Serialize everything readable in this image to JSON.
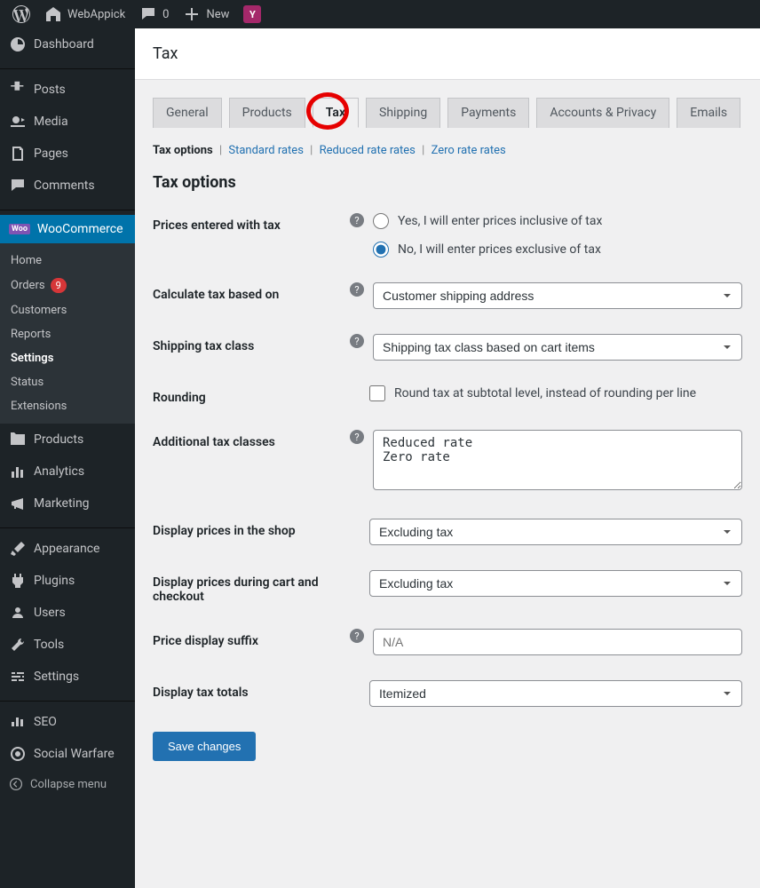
{
  "adminbar": {
    "site_name": "WebAppick",
    "comments": "0",
    "new": "New"
  },
  "sidebar": {
    "dashboard": "Dashboard",
    "posts": "Posts",
    "media": "Media",
    "pages": "Pages",
    "comments": "Comments",
    "woocommerce": "WooCommerce",
    "woo_sub": {
      "home": "Home",
      "orders": "Orders",
      "orders_count": "9",
      "customers": "Customers",
      "reports": "Reports",
      "settings": "Settings",
      "status": "Status",
      "extensions": "Extensions"
    },
    "products": "Products",
    "analytics": "Analytics",
    "marketing": "Marketing",
    "appearance": "Appearance",
    "plugins": "Plugins",
    "users": "Users",
    "tools": "Tools",
    "settings": "Settings",
    "seo": "SEO",
    "social_warfare": "Social Warfare",
    "collapse": "Collapse menu"
  },
  "page": {
    "title": "Tax",
    "tabs": {
      "general": "General",
      "products": "Products",
      "tax": "Tax",
      "shipping": "Shipping",
      "payments": "Payments",
      "accounts": "Accounts & Privacy",
      "emails": "Emails"
    },
    "sublinks": {
      "tax_options": "Tax options",
      "standard": "Standard rates",
      "reduced": "Reduced rate rates",
      "zero": "Zero rate rates"
    },
    "section_title": "Tax options",
    "fields": {
      "prices_entered": {
        "label": "Prices entered with tax",
        "option_yes": "Yes, I will enter prices inclusive of tax",
        "option_no": "No, I will enter prices exclusive of tax"
      },
      "calculate_based": {
        "label": "Calculate tax based on",
        "value": "Customer shipping address"
      },
      "shipping_class": {
        "label": "Shipping tax class",
        "value": "Shipping tax class based on cart items"
      },
      "rounding": {
        "label": "Rounding",
        "option": "Round tax at subtotal level, instead of rounding per line"
      },
      "additional_classes": {
        "label": "Additional tax classes",
        "value": "Reduced rate\nZero rate"
      },
      "display_shop": {
        "label": "Display prices in the shop",
        "value": "Excluding tax"
      },
      "display_cart": {
        "label": "Display prices during cart and checkout",
        "value": "Excluding tax"
      },
      "suffix": {
        "label": "Price display suffix",
        "placeholder": "N/A"
      },
      "totals": {
        "label": "Display tax totals",
        "value": "Itemized"
      }
    },
    "save_button": "Save changes"
  }
}
